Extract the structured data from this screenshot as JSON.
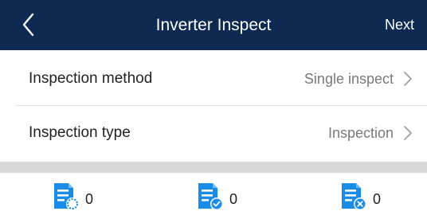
{
  "header": {
    "title": "Inverter Inspect",
    "next_label": "Next",
    "back_icon": "chevron-left-icon",
    "background_color": "#0f2a52"
  },
  "settings": [
    {
      "label": "Inspection method",
      "value": "Single inspect"
    },
    {
      "label": "Inspection type",
      "value": "Inspection"
    }
  ],
  "stats": [
    {
      "icon": "document-pending-icon",
      "count": "0"
    },
    {
      "icon": "document-check-icon",
      "count": "0"
    },
    {
      "icon": "document-error-icon",
      "count": "0"
    }
  ],
  "colors": {
    "icon_blue": "#1a8ce8",
    "section_gap": "#d8d8d8"
  }
}
